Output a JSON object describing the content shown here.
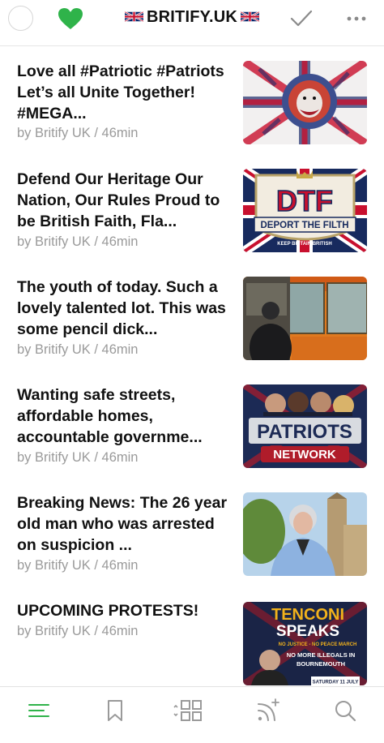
{
  "header": {
    "title": "BRITIFY.UK",
    "flag_icon": "union-jack-flag",
    "left_icon": "circle-select-icon",
    "heart_icon": "heart-icon",
    "check_icon": "checkmark-icon",
    "more_icon": "more-icon"
  },
  "colors": {
    "accent": "#2fb34a",
    "meta_text": "#9a9a9a",
    "icon_gray": "#9a9a9a"
  },
  "feed": [
    {
      "title": "Love all #Patriotic #Patriots Let’s all Unite Together! #MEGA...",
      "meta": "by Britify UK / 46min",
      "thumb": "lion-union-jack-image"
    },
    {
      "title": "Defend Our Heritage Our Nation, Our Rules Proud to be British Faith, Fla...",
      "meta": "by Britify UK / 46min",
      "thumb": "dtf-badge-image",
      "thumb_text": {
        "big": "DTF",
        "banner": "DEPORT THE FILTH",
        "small": "KEEP BRITAIN BRITISH"
      }
    },
    {
      "title": "The youth of today. Such a lovely talented lot. This was some pencil dick...",
      "meta": "by Britify UK / 46min",
      "thumb": "bus-photo-image"
    },
    {
      "title": "Wanting safe streets, affordable homes, accountable governme...",
      "meta": "by Britify UK / 46min",
      "thumb": "patriots-network-image",
      "thumb_text": {
        "line1": "PATRIOTS",
        "line2": "NETWORK"
      }
    },
    {
      "title": "Breaking News: The 26 year old man who was arrested on suspicion ...",
      "meta": "by Britify UK / 46min",
      "thumb": "woman-westminster-photo"
    },
    {
      "title": "UPCOMING PROTESTS!",
      "meta": "by Britify UK / 46min",
      "thumb": "tenconi-speaks-poster",
      "thumb_text": {
        "line1": "TENCONI",
        "line2": "SPEAKS",
        "line3": "NO JUSTICE - NO PEACE MARCH",
        "line4": "NO MORE ILLEGALS IN",
        "line5": "BOURNEMOUTH",
        "line6": "SATURDAY 11 JULY"
      }
    }
  ],
  "tabbar": [
    {
      "icon": "feed-list-icon",
      "active": true
    },
    {
      "icon": "bookmark-icon",
      "active": false
    },
    {
      "icon": "grid-icon",
      "active": false
    },
    {
      "icon": "rss-add-icon",
      "active": false
    },
    {
      "icon": "search-icon",
      "active": false
    }
  ]
}
